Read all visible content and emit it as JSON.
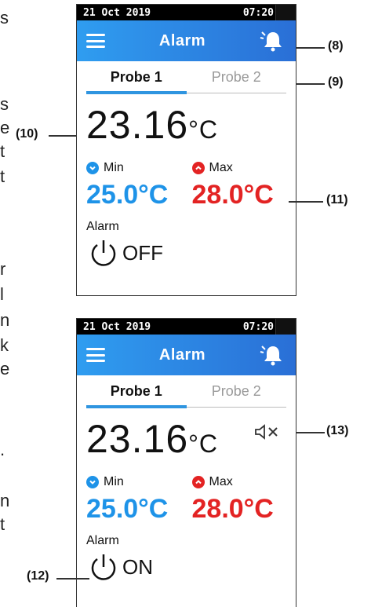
{
  "left_edge_text": [
    "s",
    "s",
    "e",
    "t",
    "t",
    "r",
    "l",
    "n",
    "k",
    "e",
    ".",
    "n",
    "t"
  ],
  "screens": [
    {
      "status": {
        "date": "21 Oct 2019",
        "time": "07:20"
      },
      "header": {
        "title": "Alarm",
        "menu_icon": "hamburger-menu-icon",
        "bell_icon": "alarm-bell-icon"
      },
      "tabs": [
        {
          "label": "Probe 1",
          "active": true
        },
        {
          "label": "Probe 2",
          "active": false
        }
      ],
      "temperature": {
        "value": "23.16",
        "unit": "°C"
      },
      "min": {
        "label": "Min",
        "value": "25.0°C"
      },
      "max": {
        "label": "Max",
        "value": "28.0°C"
      },
      "alarm": {
        "label": "Alarm",
        "state": "OFF"
      }
    },
    {
      "status": {
        "date": "21 Oct 2019",
        "time": "07:20"
      },
      "header": {
        "title": "Alarm",
        "menu_icon": "hamburger-menu-icon",
        "bell_icon": "alarm-bell-icon"
      },
      "tabs": [
        {
          "label": "Probe 1",
          "active": true
        },
        {
          "label": "Probe 2",
          "active": false
        }
      ],
      "temperature": {
        "value": "23.16",
        "unit": "°C"
      },
      "mute_icon": "speaker-muted-icon",
      "min": {
        "label": "Min",
        "value": "25.0°C"
      },
      "max": {
        "label": "Max",
        "value": "28.0°C"
      },
      "alarm": {
        "label": "Alarm",
        "state": "ON"
      }
    }
  ],
  "callouts": {
    "c8": "(8)",
    "c9": "(9)",
    "c10": "(10)",
    "c11": "(11)",
    "c12": "(12)",
    "c13": "(13)"
  },
  "colors": {
    "header_start": "#2f9df0",
    "header_end": "#2a6fd6",
    "min_blue": "#1e93e8",
    "max_red": "#e32323",
    "tab_underline": "#2f95e0"
  }
}
